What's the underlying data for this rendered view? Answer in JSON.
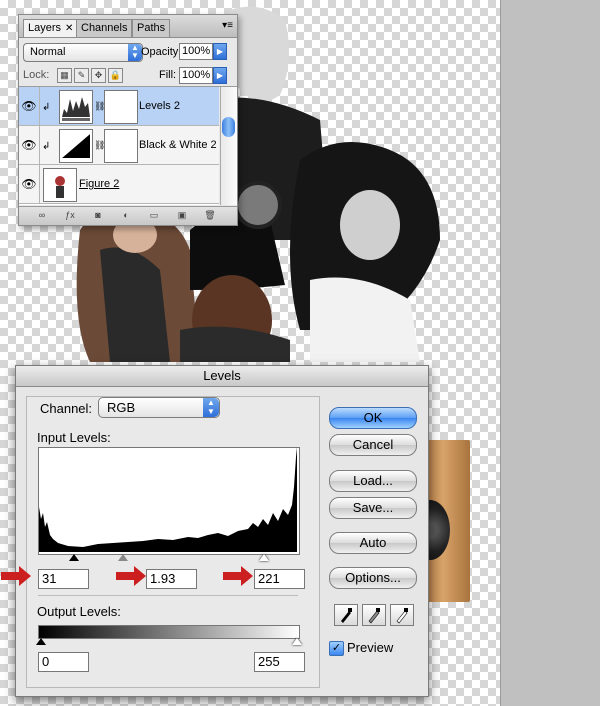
{
  "layers_panel": {
    "tabs": [
      "Layers",
      "Channels",
      "Paths"
    ],
    "blend_mode": "Normal",
    "opacity_label": "Opacity:",
    "opacity_value": "100%",
    "lock_label": "Lock:",
    "fill_label": "Fill:",
    "fill_value": "100%",
    "layers": [
      {
        "name": "Levels 2",
        "selected": true
      },
      {
        "name": "Black & White 2",
        "selected": false
      },
      {
        "name": "Figure 2",
        "selected": false
      }
    ]
  },
  "levels_dialog": {
    "title": "Levels",
    "channel_label": "Channel:",
    "channel_value": "RGB",
    "input_levels_label": "Input Levels:",
    "input_black": "31",
    "input_gamma": "1.93",
    "input_white": "221",
    "output_levels_label": "Output Levels:",
    "output_black": "0",
    "output_white": "255",
    "buttons": {
      "ok": "OK",
      "cancel": "Cancel",
      "load": "Load...",
      "save": "Save...",
      "auto": "Auto",
      "options": "Options..."
    },
    "preview_label": "Preview",
    "preview_checked": true
  },
  "colors": {
    "accent_blue": "#3a86ef",
    "annotation_red": "#cc1f1f",
    "selected_layer": "#b7d2f5"
  }
}
